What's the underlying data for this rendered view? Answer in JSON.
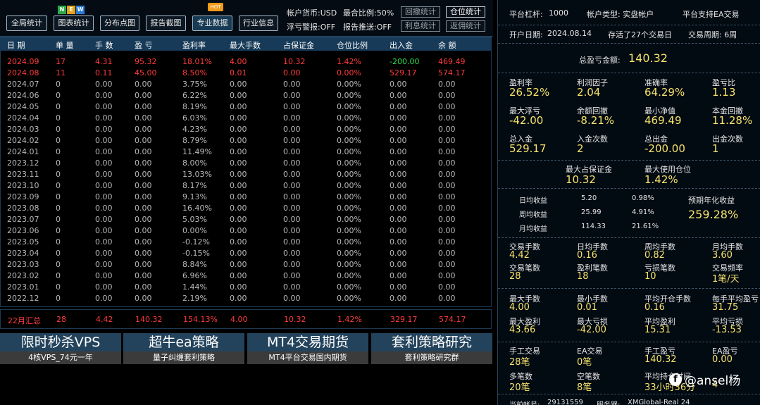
{
  "toolbar": {
    "buttons": [
      "全局统计",
      "图表统计",
      "分布点图",
      "报告截图",
      "专业数据",
      "行业信息"
    ],
    "badges": {
      "new": [
        "N",
        "E",
        "W"
      ],
      "hot": "HOT"
    },
    "account_currency": "帐户货币:USD",
    "max_ratio": "最合比例:50%",
    "float_alert": "浮亏警报:OFF",
    "report_push": "报告推送:OFF",
    "side_buttons": [
      "回撤统计",
      "仓位统计",
      "利息统计",
      "返佣统计"
    ]
  },
  "table": {
    "headers": [
      "日 期",
      "单 量",
      "手 数",
      "盈 亏",
      "盈利率",
      "最大手数",
      "占保证金",
      "仓位比例",
      "出入金",
      "余 额"
    ],
    "rows": [
      [
        "2024.09",
        "17",
        "4.31",
        "95.32",
        "18.01%",
        "4.00",
        "10.32",
        "1.42%",
        "-200.00",
        "469.49"
      ],
      [
        "2024.08",
        "11",
        "0.11",
        "45.00",
        "8.50%",
        "0.01",
        "0.00",
        "0.00%",
        "529.17",
        "574.17"
      ],
      [
        "2024.07",
        "0",
        "0.00",
        "0.00",
        "3.75%",
        "0.00",
        "0.00",
        "0.00%",
        "0.00",
        "0.00"
      ],
      [
        "2024.06",
        "0",
        "0.00",
        "0.00",
        "6.22%",
        "0.00",
        "0.00",
        "0.00%",
        "0.00",
        "0.00"
      ],
      [
        "2024.05",
        "0",
        "0.00",
        "0.00",
        "8.19%",
        "0.00",
        "0.00",
        "0.00%",
        "0.00",
        "0.00"
      ],
      [
        "2024.04",
        "0",
        "0.00",
        "0.00",
        "6.03%",
        "0.00",
        "0.00",
        "0.00%",
        "0.00",
        "0.00"
      ],
      [
        "2024.03",
        "0",
        "0.00",
        "0.00",
        "4.23%",
        "0.00",
        "0.00",
        "0.00%",
        "0.00",
        "0.00"
      ],
      [
        "2024.02",
        "0",
        "0.00",
        "0.00",
        "8.79%",
        "0.00",
        "0.00",
        "0.00%",
        "0.00",
        "0.00"
      ],
      [
        "2024.01",
        "0",
        "0.00",
        "0.00",
        "11.49%",
        "0.00",
        "0.00",
        "0.00%",
        "0.00",
        "0.00"
      ],
      [
        "2023.12",
        "0",
        "0.00",
        "0.00",
        "8.00%",
        "0.00",
        "0.00",
        "0.00%",
        "0.00",
        "0.00"
      ],
      [
        "2023.11",
        "0",
        "0.00",
        "0.00",
        "13.03%",
        "0.00",
        "0.00",
        "0.00%",
        "0.00",
        "0.00"
      ],
      [
        "2023.10",
        "0",
        "0.00",
        "0.00",
        "8.17%",
        "0.00",
        "0.00",
        "0.00%",
        "0.00",
        "0.00"
      ],
      [
        "2023.09",
        "0",
        "0.00",
        "0.00",
        "9.13%",
        "0.00",
        "0.00",
        "0.00%",
        "0.00",
        "0.00"
      ],
      [
        "2023.08",
        "0",
        "0.00",
        "0.00",
        "16.40%",
        "0.00",
        "0.00",
        "0.00%",
        "0.00",
        "0.00"
      ],
      [
        "2023.07",
        "0",
        "0.00",
        "0.00",
        "5.03%",
        "0.00",
        "0.00",
        "0.00%",
        "0.00",
        "0.00"
      ],
      [
        "2023.06",
        "0",
        "0.00",
        "0.00",
        "0.00%",
        "0.00",
        "0.00",
        "0.00%",
        "0.00",
        "0.00"
      ],
      [
        "2023.05",
        "0",
        "0.00",
        "0.00",
        "-0.12%",
        "0.00",
        "0.00",
        "0.00%",
        "0.00",
        "0.00"
      ],
      [
        "2023.04",
        "0",
        "0.00",
        "0.00",
        "-0.15%",
        "0.00",
        "0.00",
        "0.00%",
        "0.00",
        "0.00"
      ],
      [
        "2023.03",
        "0",
        "0.00",
        "0.00",
        "8.84%",
        "0.00",
        "0.00",
        "0.00%",
        "0.00",
        "0.00"
      ],
      [
        "2023.02",
        "0",
        "0.00",
        "0.00",
        "6.96%",
        "0.00",
        "0.00",
        "0.00%",
        "0.00",
        "0.00"
      ],
      [
        "2023.01",
        "0",
        "0.00",
        "0.00",
        "1.44%",
        "0.00",
        "0.00",
        "0.00%",
        "0.00",
        "0.00"
      ],
      [
        "2022.12",
        "0",
        "0.00",
        "0.00",
        "2.19%",
        "0.00",
        "0.00",
        "0.00%",
        "0.00",
        "0.00"
      ]
    ],
    "summary": [
      "22月汇总",
      "28",
      "4.42",
      "140.32",
      "154.13%",
      "4.00",
      "10.32",
      "1.42%",
      "329.17",
      "574.17"
    ]
  },
  "promos": [
    {
      "title": "限时秒杀VPS",
      "sub": "4核VPS_74元一年"
    },
    {
      "title": "超牛ea策略",
      "sub": "量子纠缠套利策略"
    },
    {
      "title": "MT4交易期货",
      "sub": "MT4平台交易国内期货"
    },
    {
      "title": "套利策略研究",
      "sub": "套利策略研究群"
    }
  ],
  "right": {
    "leverage_label": "平台杠杆:",
    "leverage": "1000",
    "account_type": "帐户类型: 实盘帐户",
    "ea_support": "平台支持EA交易",
    "open_date_label": "开户日期:",
    "open_date": "2024.08.14",
    "survival": "存活了27个交易日",
    "cycle": "交易周期: 6周",
    "total_pl_label": "总盈亏金额:",
    "total_pl": "140.32",
    "grid1": [
      {
        "label": "盈利率",
        "value": "26.52%"
      },
      {
        "label": "利润因子",
        "value": "2.04"
      },
      {
        "label": "准确率",
        "value": "64.29%"
      },
      {
        "label": "盈亏比",
        "value": "1.13"
      },
      {
        "label": "最大浮亏",
        "value": "-42.00"
      },
      {
        "label": "余额回撤",
        "value": "-8.21%"
      },
      {
        "label": "最小净值",
        "value": "469.49"
      },
      {
        "label": "本金回撤",
        "value": "11.28%"
      },
      {
        "label": "总入金",
        "value": "529.17"
      },
      {
        "label": "入金次数",
        "value": "2"
      },
      {
        "label": "总出金",
        "value": "-200.00"
      },
      {
        "label": "出金次数",
        "value": "1"
      }
    ],
    "margin": [
      {
        "label": "最大占保证金",
        "value": "10.32"
      },
      {
        "label": "最大使用仓位",
        "value": "1.42%"
      }
    ],
    "returns": [
      {
        "label": "日均收益",
        "amount": "5.20",
        "pct": "0.98%"
      },
      {
        "label": "周均收益",
        "amount": "25.99",
        "pct": "4.91%"
      },
      {
        "label": "月均收益",
        "amount": "114.33",
        "pct": "21.61%"
      }
    ],
    "annual_label": "预期年化收益",
    "annual": "259.28%",
    "grid2": [
      {
        "label": "交易手数",
        "value": "4.42"
      },
      {
        "label": "日均手数",
        "value": "0.16"
      },
      {
        "label": "周均手数",
        "value": "0.82"
      },
      {
        "label": "月均手数",
        "value": "3.60"
      },
      {
        "label": "交易笔数",
        "value": "28"
      },
      {
        "label": "盈利笔数",
        "value": "18"
      },
      {
        "label": "亏损笔数",
        "value": "10"
      },
      {
        "label": "交易频率",
        "value": "1笔/天"
      }
    ],
    "grid3": [
      {
        "label": "最大手数",
        "value": "4.00"
      },
      {
        "label": "最小手数",
        "value": "0.01"
      },
      {
        "label": "平均开仓手数",
        "value": "0.16"
      },
      {
        "label": "每手平均盈亏",
        "value": "31.75"
      },
      {
        "label": "最大盈利",
        "value": "43.66"
      },
      {
        "label": "最大亏损",
        "value": "-42.00"
      },
      {
        "label": "平均盈利",
        "value": "15.31"
      },
      {
        "label": "平均亏损",
        "value": "-13.53"
      }
    ],
    "grid4": [
      {
        "label": "手工交易",
        "value": "28笔"
      },
      {
        "label": "EA交易",
        "value": "0笔"
      },
      {
        "label": "手工盈亏",
        "value": "140.32"
      },
      {
        "label": "EA盈亏",
        "value": "0.00"
      },
      {
        "label": "多笔数",
        "value": "20笔"
      },
      {
        "label": "空笔数",
        "value": "8笔"
      },
      {
        "label": "平均持仓时间",
        "value": "33小时36分"
      },
      {
        "label": "",
        "value": "4"
      }
    ],
    "account_label": "当前帐号:",
    "account": "29131559",
    "server_label": "服务器:",
    "server": "XMGlobal-Real 24"
  },
  "watermark": {
    "icon": "f",
    "text": "@ansel杨"
  },
  "colors": {
    "accent": "#173a58",
    "red": "#ff3b3b",
    "yellow": "#f6e36b",
    "green": "#2ddc4e"
  }
}
